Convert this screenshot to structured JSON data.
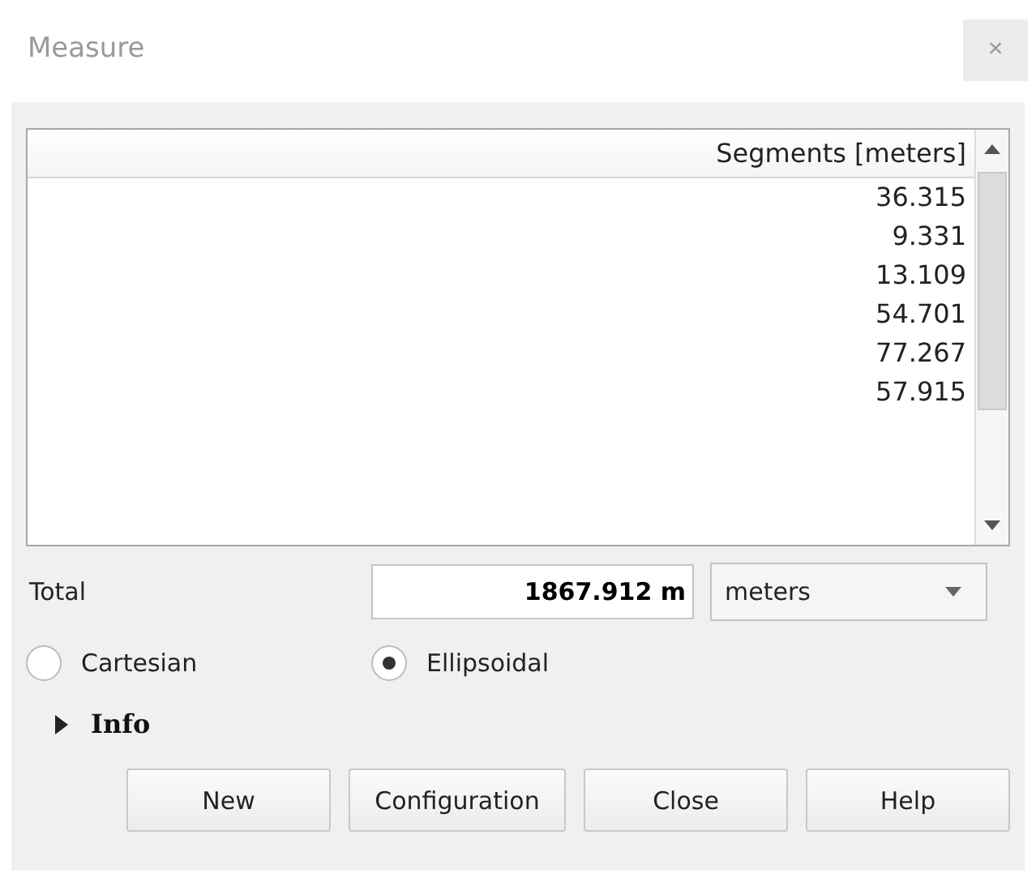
{
  "window": {
    "title": "Measure",
    "close_glyph": "×"
  },
  "table": {
    "columns": [
      "Segments [meters]"
    ],
    "rows": [
      "36.315",
      "9.331",
      "13.109",
      "54.701",
      "77.267",
      "57.915"
    ]
  },
  "total": {
    "label": "Total",
    "value": "1867.912 m",
    "unit": "meters"
  },
  "modes": [
    {
      "label": "Cartesian",
      "selected": false
    },
    {
      "label": "Ellipsoidal",
      "selected": true
    }
  ],
  "info": {
    "label": "Info",
    "expanded": false
  },
  "buttons": [
    "New",
    "Configuration",
    "Close",
    "Help"
  ]
}
